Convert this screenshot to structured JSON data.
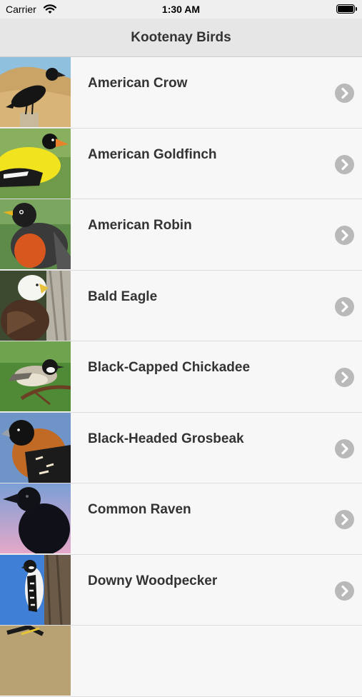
{
  "status": {
    "carrier": "Carrier",
    "time": "1:30 AM"
  },
  "navbar": {
    "title": "Kootenay Birds"
  },
  "birds": [
    {
      "name": "American Crow",
      "icon": "american-crow-photo"
    },
    {
      "name": "American Goldfinch",
      "icon": "american-goldfinch-photo"
    },
    {
      "name": "American Robin",
      "icon": "american-robin-photo"
    },
    {
      "name": "Bald Eagle",
      "icon": "bald-eagle-photo"
    },
    {
      "name": "Black-Capped Chickadee",
      "icon": "black-capped-chickadee-photo"
    },
    {
      "name": "Black-Headed Grosbeak",
      "icon": "black-headed-grosbeak-photo"
    },
    {
      "name": "Common Raven",
      "icon": "common-raven-photo"
    },
    {
      "name": "Downy Woodpecker",
      "icon": "downy-woodpecker-photo"
    }
  ]
}
